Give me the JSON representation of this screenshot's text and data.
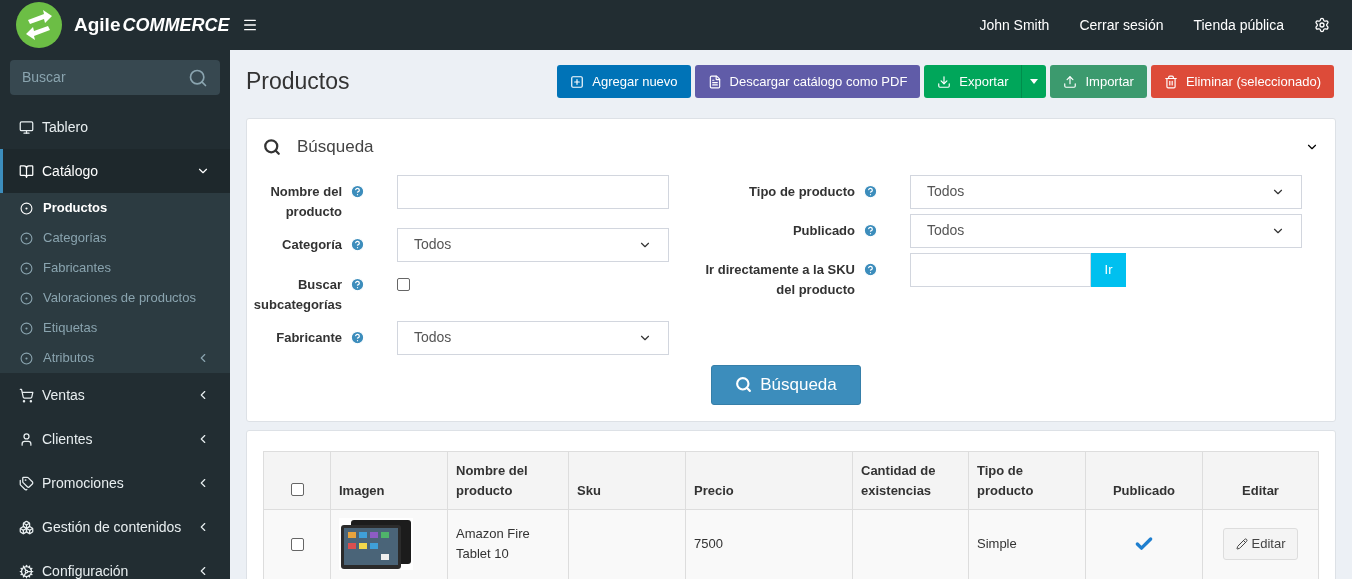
{
  "brand": {
    "name": "Agile",
    "suffix": "COMMERCE"
  },
  "topbar": {
    "links": [
      "John Smith",
      "Cerrar sesión",
      "Tienda pública"
    ]
  },
  "sidebar": {
    "search": {
      "placeholder": "Buscar"
    },
    "items": [
      {
        "label": "Tablero",
        "selected": false
      },
      {
        "label": "Catálogo",
        "selected": true,
        "expanded": true,
        "children": [
          {
            "label": "Productos",
            "selected": true
          },
          {
            "label": "Categorías",
            "selected": false
          },
          {
            "label": "Fabricantes",
            "selected": false
          },
          {
            "label": "Valoraciones de productos",
            "selected": false
          },
          {
            "label": "Etiquetas",
            "selected": false
          },
          {
            "label": "Atributos",
            "selected": false,
            "expanded": false
          }
        ]
      },
      {
        "label": "Ventas",
        "selected": false,
        "expanded": false
      },
      {
        "label": "Clientes",
        "selected": false,
        "expanded": false
      },
      {
        "label": "Promociones",
        "selected": false,
        "expanded": false
      },
      {
        "label": "Gestión de contenidos",
        "selected": false,
        "expanded": false
      },
      {
        "label": "Configuración",
        "selected": false,
        "expanded": false
      }
    ]
  },
  "page": {
    "title": "Productos"
  },
  "actions": [
    {
      "label": "Agregar nuevo",
      "color": "#0073b7"
    },
    {
      "label": "Descargar catálogo como PDF",
      "color": "#605ca8"
    },
    {
      "label": "Exportar",
      "color": "#00a65a",
      "split": true
    },
    {
      "label": "Importar",
      "color": "#3c9a6e"
    },
    {
      "label": "Eliminar (seleccionado)",
      "color": "#dd4b39"
    }
  ],
  "search_panel": {
    "title": "Búsqueda",
    "expanded": true,
    "left": [
      {
        "kind": "text",
        "label": "Nombre del producto"
      },
      {
        "kind": "select",
        "label": "Categoría",
        "value": "Todos"
      },
      {
        "kind": "checkbox",
        "label": "Buscar subcategorías",
        "checked": false
      },
      {
        "kind": "select",
        "label": "Fabricante",
        "value": "Todos"
      }
    ],
    "right": [
      {
        "kind": "select",
        "label": "Tipo de producto",
        "value": "Todos"
      },
      {
        "kind": "select",
        "label": "Publicado",
        "value": "Todos"
      },
      {
        "kind": "go",
        "label": "Ir directamente a la SKU del producto",
        "button": "Ir"
      }
    ],
    "submit": "Búsqueda"
  },
  "table": {
    "select_all": {
      "checked": false
    },
    "columns": [
      "Imagen",
      "Nombre del producto",
      "Sku",
      "Precio",
      "Cantidad de existencias",
      "Tipo de producto",
      "Publicado",
      "Editar"
    ],
    "rows": [
      {
        "checked": false,
        "name": "Amazon Fire Tablet 10",
        "price": "7500",
        "type": "Simple",
        "published": true,
        "edit": "Editar"
      }
    ]
  }
}
